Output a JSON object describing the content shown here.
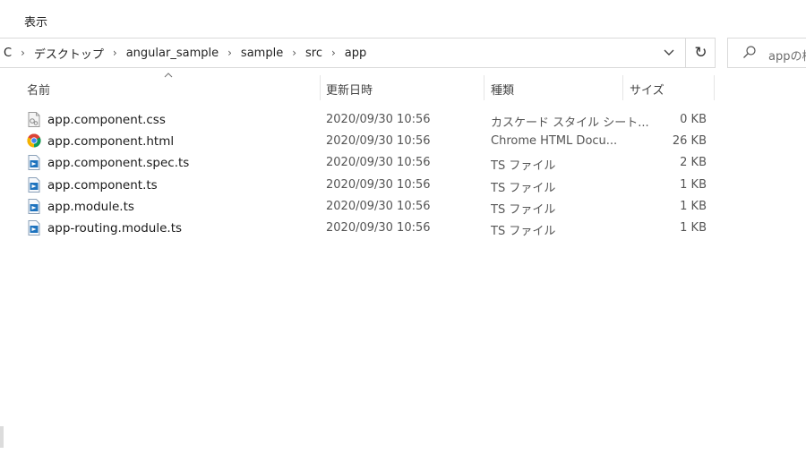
{
  "ribbon": {
    "tab_view": "表示"
  },
  "address": {
    "crumbs": [
      "C",
      "デスクトップ",
      "angular_sample",
      "sample",
      "src",
      "app"
    ],
    "refresh_glyph": "↻"
  },
  "search": {
    "placeholder": "appの検"
  },
  "columns": {
    "name": "名前",
    "date": "更新日時",
    "type": "種類",
    "size": "サイズ"
  },
  "files": [
    {
      "name": "app.component.css",
      "date": "2020/09/30 10:56",
      "type": "カスケード スタイル シート...",
      "size": "0 KB",
      "icon": "css-file-icon"
    },
    {
      "name": "app.component.html",
      "date": "2020/09/30 10:56",
      "type": "Chrome HTML Docu...",
      "size": "26 KB",
      "icon": "chrome-html-file-icon"
    },
    {
      "name": "app.component.spec.ts",
      "date": "2020/09/30 10:56",
      "type": "TS ファイル",
      "size": "2 KB",
      "icon": "ts-file-icon"
    },
    {
      "name": "app.component.ts",
      "date": "2020/09/30 10:56",
      "type": "TS ファイル",
      "size": "1 KB",
      "icon": "ts-file-icon"
    },
    {
      "name": "app.module.ts",
      "date": "2020/09/30 10:56",
      "type": "TS ファイル",
      "size": "1 KB",
      "icon": "ts-file-icon"
    },
    {
      "name": "app-routing.module.ts",
      "date": "2020/09/30 10:56",
      "type": "TS ファイル",
      "size": "1 KB",
      "icon": "ts-file-icon"
    }
  ],
  "colors": {
    "border": "#d9d9d9",
    "ts_blue": "#1e73be",
    "header_text": "#444444"
  }
}
